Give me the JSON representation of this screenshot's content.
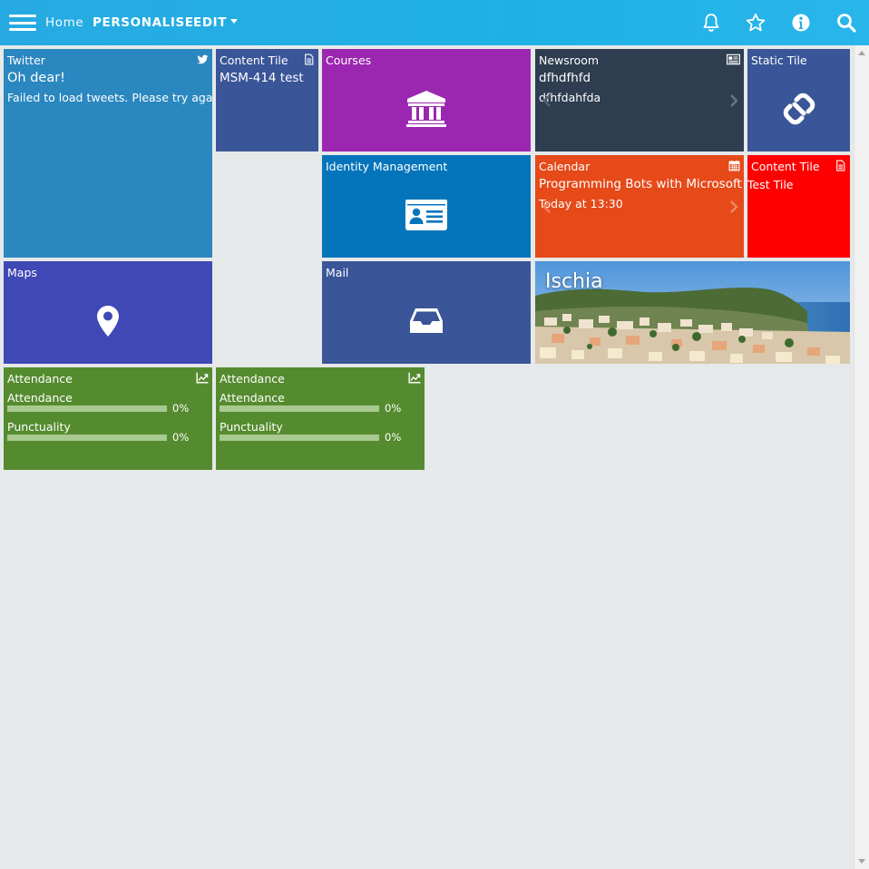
{
  "header": {
    "nav": {
      "home": "Home",
      "personalise": "PERSONALISE",
      "edit": "EDIT"
    },
    "icons": [
      "menu-icon",
      "bell-icon",
      "star-icon",
      "info-icon",
      "search-icon"
    ]
  },
  "tiles": {
    "twitter": {
      "title": "Twitter",
      "headline": "Oh dear!",
      "message": "Failed to load tweets. Please try again.",
      "color": "#2b87bf",
      "icon": "twitter-icon"
    },
    "content1": {
      "title": "Content Tile",
      "body": "MSM-414 test",
      "color": "#3a5598",
      "icon": "document-icon"
    },
    "courses": {
      "title": "Courses",
      "color": "#9b27b0",
      "icon": "institution-icon"
    },
    "newsroom": {
      "title": "Newsroom",
      "headline": "dfhdfhfd",
      "body": "dfhfdahfda",
      "color": "#2e3d50",
      "icon": "newspaper-icon"
    },
    "static": {
      "title": "Static Tile",
      "color": "#3a5598",
      "icon": "link-icon"
    },
    "identity": {
      "title": "Identity Management",
      "color": "#0475bb",
      "icon": "id-card-icon"
    },
    "calendar": {
      "title": "Calendar",
      "headline": "Programming Bots with Microsoft",
      "body": "Today at 13:30",
      "color": "#e64a19",
      "icon": "calendar-icon"
    },
    "content2": {
      "title": "Content Tile",
      "body": "Test Tile",
      "color": "#ff0000",
      "icon": "document-icon"
    },
    "maps": {
      "title": "Maps",
      "color": "#3f48b5",
      "icon": "map-pin-icon"
    },
    "mail": {
      "title": "Mail",
      "color": "#3a5598",
      "icon": "inbox-icon"
    },
    "ischia": {
      "title": "Ischia"
    },
    "attendance1": {
      "title": "Attendance",
      "color": "#558b2f",
      "icon": "chart-line-icon",
      "rows": [
        {
          "label": "Attendance",
          "value": "0%",
          "fraction": 0
        },
        {
          "label": "Punctuality",
          "value": "0%",
          "fraction": 0
        }
      ]
    },
    "attendance2": {
      "title": "Attendance",
      "color": "#558b2f",
      "icon": "chart-line-icon",
      "rows": [
        {
          "label": "Attendance",
          "value": "0%",
          "fraction": 0
        },
        {
          "label": "Punctuality",
          "value": "0%",
          "fraction": 0
        }
      ]
    }
  }
}
